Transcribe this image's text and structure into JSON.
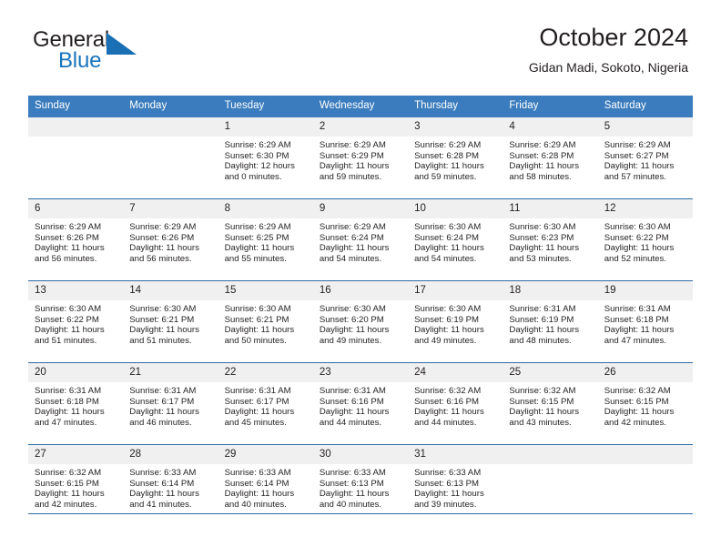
{
  "brand": {
    "name_part1": "General",
    "name_part2": "Blue",
    "accent_color": "#1a75bc",
    "triangle_icon": "triangle-logo-icon"
  },
  "header": {
    "title": "October 2024",
    "subtitle": "Gidan Madi, Sokoto, Nigeria",
    "header_bg_color": "#3a7cbe",
    "rule_color": "#2e6da4"
  },
  "calendar": {
    "weekday_headers": [
      "Sunday",
      "Monday",
      "Tuesday",
      "Wednesday",
      "Thursday",
      "Friday",
      "Saturday"
    ],
    "weeks": [
      [
        {
          "day": "",
          "lines": []
        },
        {
          "day": "",
          "lines": []
        },
        {
          "day": "1",
          "lines": [
            "Sunrise: 6:29 AM",
            "Sunset: 6:30 PM",
            "Daylight: 12 hours",
            "and 0 minutes."
          ]
        },
        {
          "day": "2",
          "lines": [
            "Sunrise: 6:29 AM",
            "Sunset: 6:29 PM",
            "Daylight: 11 hours",
            "and 59 minutes."
          ]
        },
        {
          "day": "3",
          "lines": [
            "Sunrise: 6:29 AM",
            "Sunset: 6:28 PM",
            "Daylight: 11 hours",
            "and 59 minutes."
          ]
        },
        {
          "day": "4",
          "lines": [
            "Sunrise: 6:29 AM",
            "Sunset: 6:28 PM",
            "Daylight: 11 hours",
            "and 58 minutes."
          ]
        },
        {
          "day": "5",
          "lines": [
            "Sunrise: 6:29 AM",
            "Sunset: 6:27 PM",
            "Daylight: 11 hours",
            "and 57 minutes."
          ]
        }
      ],
      [
        {
          "day": "6",
          "lines": [
            "Sunrise: 6:29 AM",
            "Sunset: 6:26 PM",
            "Daylight: 11 hours",
            "and 56 minutes."
          ]
        },
        {
          "day": "7",
          "lines": [
            "Sunrise: 6:29 AM",
            "Sunset: 6:26 PM",
            "Daylight: 11 hours",
            "and 56 minutes."
          ]
        },
        {
          "day": "8",
          "lines": [
            "Sunrise: 6:29 AM",
            "Sunset: 6:25 PM",
            "Daylight: 11 hours",
            "and 55 minutes."
          ]
        },
        {
          "day": "9",
          "lines": [
            "Sunrise: 6:29 AM",
            "Sunset: 6:24 PM",
            "Daylight: 11 hours",
            "and 54 minutes."
          ]
        },
        {
          "day": "10",
          "lines": [
            "Sunrise: 6:30 AM",
            "Sunset: 6:24 PM",
            "Daylight: 11 hours",
            "and 54 minutes."
          ]
        },
        {
          "day": "11",
          "lines": [
            "Sunrise: 6:30 AM",
            "Sunset: 6:23 PM",
            "Daylight: 11 hours",
            "and 53 minutes."
          ]
        },
        {
          "day": "12",
          "lines": [
            "Sunrise: 6:30 AM",
            "Sunset: 6:22 PM",
            "Daylight: 11 hours",
            "and 52 minutes."
          ]
        }
      ],
      [
        {
          "day": "13",
          "lines": [
            "Sunrise: 6:30 AM",
            "Sunset: 6:22 PM",
            "Daylight: 11 hours",
            "and 51 minutes."
          ]
        },
        {
          "day": "14",
          "lines": [
            "Sunrise: 6:30 AM",
            "Sunset: 6:21 PM",
            "Daylight: 11 hours",
            "and 51 minutes."
          ]
        },
        {
          "day": "15",
          "lines": [
            "Sunrise: 6:30 AM",
            "Sunset: 6:21 PM",
            "Daylight: 11 hours",
            "and 50 minutes."
          ]
        },
        {
          "day": "16",
          "lines": [
            "Sunrise: 6:30 AM",
            "Sunset: 6:20 PM",
            "Daylight: 11 hours",
            "and 49 minutes."
          ]
        },
        {
          "day": "17",
          "lines": [
            "Sunrise: 6:30 AM",
            "Sunset: 6:19 PM",
            "Daylight: 11 hours",
            "and 49 minutes."
          ]
        },
        {
          "day": "18",
          "lines": [
            "Sunrise: 6:31 AM",
            "Sunset: 6:19 PM",
            "Daylight: 11 hours",
            "and 48 minutes."
          ]
        },
        {
          "day": "19",
          "lines": [
            "Sunrise: 6:31 AM",
            "Sunset: 6:18 PM",
            "Daylight: 11 hours",
            "and 47 minutes."
          ]
        }
      ],
      [
        {
          "day": "20",
          "lines": [
            "Sunrise: 6:31 AM",
            "Sunset: 6:18 PM",
            "Daylight: 11 hours",
            "and 47 minutes."
          ]
        },
        {
          "day": "21",
          "lines": [
            "Sunrise: 6:31 AM",
            "Sunset: 6:17 PM",
            "Daylight: 11 hours",
            "and 46 minutes."
          ]
        },
        {
          "day": "22",
          "lines": [
            "Sunrise: 6:31 AM",
            "Sunset: 6:17 PM",
            "Daylight: 11 hours",
            "and 45 minutes."
          ]
        },
        {
          "day": "23",
          "lines": [
            "Sunrise: 6:31 AM",
            "Sunset: 6:16 PM",
            "Daylight: 11 hours",
            "and 44 minutes."
          ]
        },
        {
          "day": "24",
          "lines": [
            "Sunrise: 6:32 AM",
            "Sunset: 6:16 PM",
            "Daylight: 11 hours",
            "and 44 minutes."
          ]
        },
        {
          "day": "25",
          "lines": [
            "Sunrise: 6:32 AM",
            "Sunset: 6:15 PM",
            "Daylight: 11 hours",
            "and 43 minutes."
          ]
        },
        {
          "day": "26",
          "lines": [
            "Sunrise: 6:32 AM",
            "Sunset: 6:15 PM",
            "Daylight: 11 hours",
            "and 42 minutes."
          ]
        }
      ],
      [
        {
          "day": "27",
          "lines": [
            "Sunrise: 6:32 AM",
            "Sunset: 6:15 PM",
            "Daylight: 11 hours",
            "and 42 minutes."
          ]
        },
        {
          "day": "28",
          "lines": [
            "Sunrise: 6:33 AM",
            "Sunset: 6:14 PM",
            "Daylight: 11 hours",
            "and 41 minutes."
          ]
        },
        {
          "day": "29",
          "lines": [
            "Sunrise: 6:33 AM",
            "Sunset: 6:14 PM",
            "Daylight: 11 hours",
            "and 40 minutes."
          ]
        },
        {
          "day": "30",
          "lines": [
            "Sunrise: 6:33 AM",
            "Sunset: 6:13 PM",
            "Daylight: 11 hours",
            "and 40 minutes."
          ]
        },
        {
          "day": "31",
          "lines": [
            "Sunrise: 6:33 AM",
            "Sunset: 6:13 PM",
            "Daylight: 11 hours",
            "and 39 minutes."
          ]
        },
        {
          "day": "",
          "lines": []
        },
        {
          "day": "",
          "lines": []
        }
      ]
    ]
  }
}
